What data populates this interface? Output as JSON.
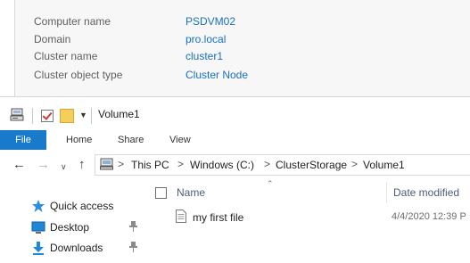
{
  "info_panel": {
    "rows": [
      {
        "label": "Computer name",
        "value": "PSDVM02"
      },
      {
        "label": "Domain",
        "value": "pro.local"
      },
      {
        "label": "Cluster name",
        "value": "cluster1"
      },
      {
        "label": "Cluster object type",
        "value": "Cluster Node"
      }
    ],
    "value_color": "#1a6fc2"
  },
  "explorer": {
    "title": "Volume1",
    "quick_access_toolbar": [
      "properties-icon",
      "checkmark-icon",
      "new-folder-icon",
      "customize-dropdown-icon"
    ],
    "ribbon_tabs": [
      "File",
      "Home",
      "Share",
      "View"
    ],
    "file_tab_color": "#1979ca",
    "address": {
      "root_icon": "this-pc-icon",
      "crumbs": [
        "This PC",
        "Windows (C:)",
        "ClusterStorage",
        "Volume1"
      ],
      "separator": ">"
    },
    "nav_buttons": [
      "back-arrow-icon",
      "forward-arrow-icon",
      "recent-locations-icon",
      "up-arrow-icon"
    ],
    "nav_pane": [
      {
        "label": "Quick access",
        "icon": "star-icon"
      },
      {
        "label": "Desktop",
        "icon": "desktop-icon",
        "pinned": true
      },
      {
        "label": "Downloads",
        "icon": "downloads-icon",
        "pinned": true
      }
    ],
    "columns": [
      "Name",
      "Date modified"
    ],
    "files": [
      {
        "name": "my first file",
        "date_modified": "4/4/2020 12:39 P"
      }
    ]
  }
}
